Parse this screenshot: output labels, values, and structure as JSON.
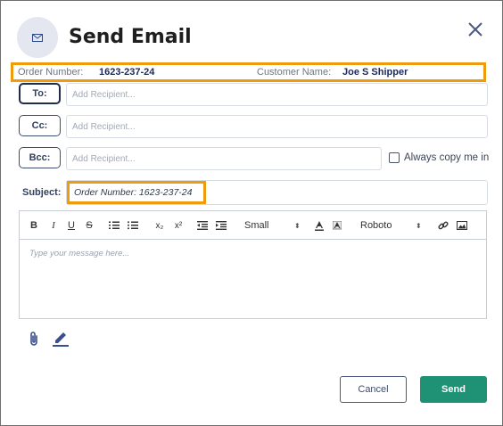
{
  "dialog": {
    "title": "Send Email",
    "avatar_icon": "envelope-icon",
    "close_icon": "close-icon"
  },
  "info_bar": {
    "order_number_label": "Order Number:",
    "order_number_value": "1623-237-24",
    "customer_name_label": "Customer Name:",
    "customer_name_value": "Joe S Shipper",
    "highlight_color": "#ef9b0f"
  },
  "recipients": {
    "to": {
      "label": "To:",
      "placeholder": "Add Recipient..."
    },
    "cc": {
      "label": "Cc:",
      "placeholder": "Add Recipient..."
    },
    "bcc": {
      "label": "Bcc:",
      "placeholder": "Add Recipient..."
    },
    "always_copy_label": "Always copy me in",
    "always_copy_checked": false
  },
  "subject": {
    "label": "Subject:",
    "value": "Order Number: 1623-237-24"
  },
  "editor": {
    "toolbar": {
      "bold": "B",
      "italic": "I",
      "underline": "U",
      "strike": "S",
      "subscript": "x₂",
      "superscript": "x²",
      "size": "Small",
      "font": "Roboto",
      "icons": [
        "bold-icon",
        "italic-icon",
        "underline-icon",
        "strikethrough-icon",
        "ordered-list-icon",
        "bullet-list-icon",
        "subscript-icon",
        "superscript-icon",
        "outdent-icon",
        "indent-icon",
        "font-size-select",
        "text-color-icon",
        "background-color-icon",
        "font-family-select",
        "link-icon",
        "image-icon"
      ]
    },
    "placeholder": "Type your message here..."
  },
  "footer": {
    "attach_icon": "paperclip-icon",
    "signature_icon": "pen-icon",
    "cancel_label": "Cancel",
    "send_label": "Send",
    "send_color": "#1f9276"
  }
}
